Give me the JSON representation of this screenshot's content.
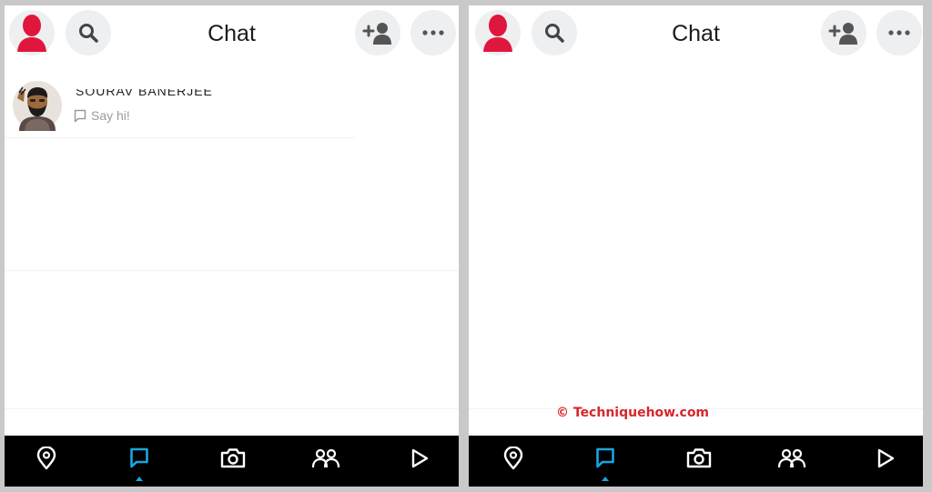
{
  "screens": {
    "left": {
      "header": {
        "title": "Chat"
      },
      "chats": [
        {
          "name": "SOURAV BANERJEE",
          "status": "Say hi!"
        }
      ]
    },
    "right": {
      "header": {
        "title": "Chat"
      },
      "watermark": "© Techniquehow.com"
    }
  },
  "bottom_nav": {
    "items": [
      "map-icon",
      "chat-icon",
      "camera-icon",
      "friends-icon",
      "discover-icon"
    ],
    "active": "chat-icon",
    "active_color": "#19a6df",
    "icon_color": "#ffffff"
  },
  "colors": {
    "profile_red": "#e0173d",
    "header_button_bg": "#eeeff1",
    "watermark": "#d9252c"
  }
}
